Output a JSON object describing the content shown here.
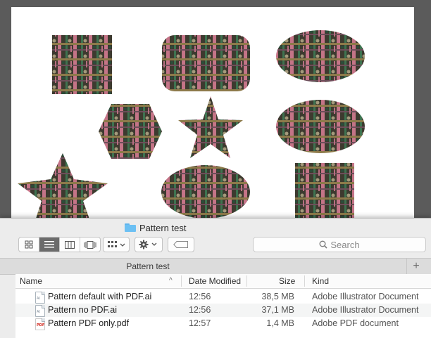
{
  "colors": {
    "accent_folder": "#6cc0f3",
    "canvas_bg": "#5b5b5b",
    "pattern_dark": "#3d3a2f",
    "pattern_pink": "#c47487",
    "pattern_green": "#3e7350"
  },
  "window": {
    "title": "Pattern test",
    "folder_icon": "folder-icon"
  },
  "toolbar": {
    "view_buttons": [
      "icon-view",
      "list-view",
      "column-view",
      "cover-flow-view"
    ],
    "active_view": "list-view",
    "arrange_icon": "group-icon",
    "action_icon": "gear-icon",
    "tag_icon": "tag-icon",
    "search_placeholder": "Search"
  },
  "pathbar": {
    "title": "Pattern test",
    "add_label": "+"
  },
  "columns": {
    "name": "Name",
    "date": "Date Modified",
    "size": "Size",
    "kind": "Kind",
    "sort_indicator": "^"
  },
  "files": [
    {
      "name": "Pattern default with PDF.ai",
      "date": "12:56",
      "size": "38,5 MB",
      "kind": "Adobe Illustrator Document",
      "icon": "ai-file-icon",
      "icon_tag": "AI"
    },
    {
      "name": "Pattern no PDF.ai",
      "date": "12:56",
      "size": "37,1 MB",
      "kind": "Adobe Illustrator Document",
      "icon": "ai-file-icon",
      "icon_tag": "AI"
    },
    {
      "name": "Pattern PDF only.pdf",
      "date": "12:57",
      "size": "1,4 MB",
      "kind": "Adobe PDF document",
      "icon": "pdf-file-icon",
      "icon_tag": "PDF"
    }
  ],
  "artboard": {
    "shapes": [
      "square",
      "rounded-rectangle",
      "ellipse",
      "hexagon",
      "star",
      "ellipse",
      "star",
      "ellipse",
      "rectangle"
    ],
    "fill": "pattern-fill"
  }
}
